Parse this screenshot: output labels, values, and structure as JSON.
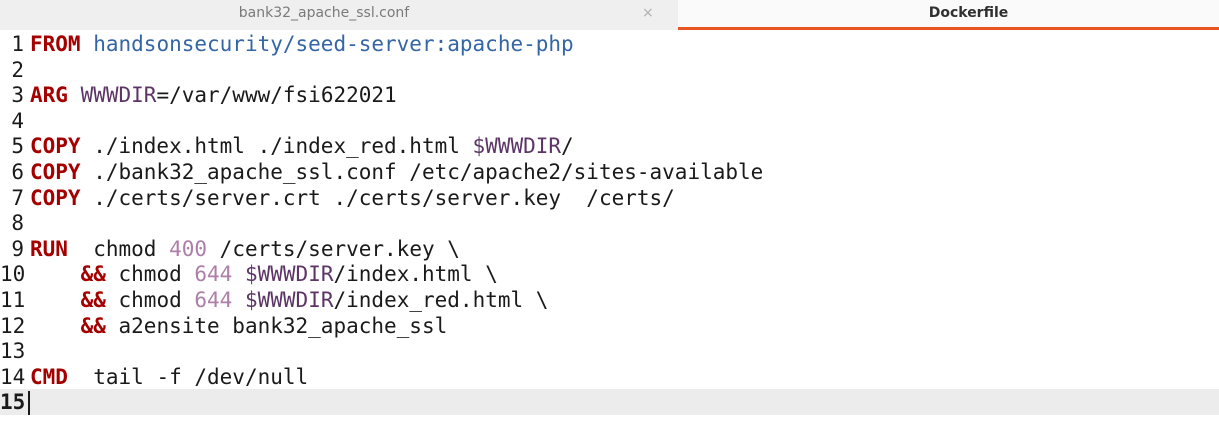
{
  "tabs": [
    {
      "label": "bank32_apache_ssl.conf",
      "active": false,
      "close_glyph": "×"
    },
    {
      "label": "Dockerfile",
      "active": true
    }
  ],
  "colors": {
    "keyword": "#a40000",
    "image": "#3465a4",
    "variable": "#5c3566",
    "number": "#ad7fa8",
    "active_tab_underline": "#e95420",
    "current_line_bg": "#ececec"
  },
  "editor": {
    "current_line": 15,
    "lines": [
      {
        "num": "1",
        "tokens": [
          {
            "t": "FROM",
            "c": "kw"
          },
          {
            "t": " ",
            "c": "plain"
          },
          {
            "t": "handsonsecurity/seed-server:apache-php",
            "c": "img"
          }
        ]
      },
      {
        "num": "2",
        "tokens": []
      },
      {
        "num": "3",
        "tokens": [
          {
            "t": "ARG",
            "c": "kw"
          },
          {
            "t": " ",
            "c": "plain"
          },
          {
            "t": "WWWDIR",
            "c": "var"
          },
          {
            "t": "=/var/www/fsi622021",
            "c": "plain"
          }
        ]
      },
      {
        "num": "4",
        "tokens": []
      },
      {
        "num": "5",
        "tokens": [
          {
            "t": "COPY",
            "c": "kw"
          },
          {
            "t": " ./index.html ./index_red.html ",
            "c": "plain"
          },
          {
            "t": "$WWWDIR",
            "c": "var"
          },
          {
            "t": "/",
            "c": "plain"
          }
        ]
      },
      {
        "num": "6",
        "tokens": [
          {
            "t": "COPY",
            "c": "kw"
          },
          {
            "t": " ./bank32_apache_ssl.conf /etc/apache2/sites-available",
            "c": "plain"
          }
        ]
      },
      {
        "num": "7",
        "tokens": [
          {
            "t": "COPY",
            "c": "kw"
          },
          {
            "t": " ./certs/server.crt ./certs/server.key  /certs/",
            "c": "plain"
          }
        ]
      },
      {
        "num": "8",
        "tokens": []
      },
      {
        "num": "9",
        "tokens": [
          {
            "t": "RUN",
            "c": "kw"
          },
          {
            "t": "  chmod ",
            "c": "plain"
          },
          {
            "t": "400",
            "c": "num"
          },
          {
            "t": " /certs/server.key \\",
            "c": "plain"
          }
        ]
      },
      {
        "num": "10",
        "tokens": [
          {
            "t": "    ",
            "c": "plain"
          },
          {
            "t": "&&",
            "c": "op"
          },
          {
            "t": " chmod ",
            "c": "plain"
          },
          {
            "t": "644",
            "c": "num"
          },
          {
            "t": " ",
            "c": "plain"
          },
          {
            "t": "$WWWDIR",
            "c": "var"
          },
          {
            "t": "/index.html \\",
            "c": "plain"
          }
        ]
      },
      {
        "num": "11",
        "tokens": [
          {
            "t": "    ",
            "c": "plain"
          },
          {
            "t": "&&",
            "c": "op"
          },
          {
            "t": " chmod ",
            "c": "plain"
          },
          {
            "t": "644",
            "c": "num"
          },
          {
            "t": " ",
            "c": "plain"
          },
          {
            "t": "$WWWDIR",
            "c": "var"
          },
          {
            "t": "/index_red.html \\",
            "c": "plain"
          }
        ]
      },
      {
        "num": "12",
        "tokens": [
          {
            "t": "    ",
            "c": "plain"
          },
          {
            "t": "&&",
            "c": "op"
          },
          {
            "t": " a2ensite bank32_apache_ssl",
            "c": "plain"
          }
        ]
      },
      {
        "num": "13",
        "tokens": []
      },
      {
        "num": "14",
        "tokens": [
          {
            "t": "CMD",
            "c": "kw"
          },
          {
            "t": "  tail -f /dev/null",
            "c": "plain"
          }
        ]
      },
      {
        "num": "15",
        "tokens": []
      }
    ]
  }
}
